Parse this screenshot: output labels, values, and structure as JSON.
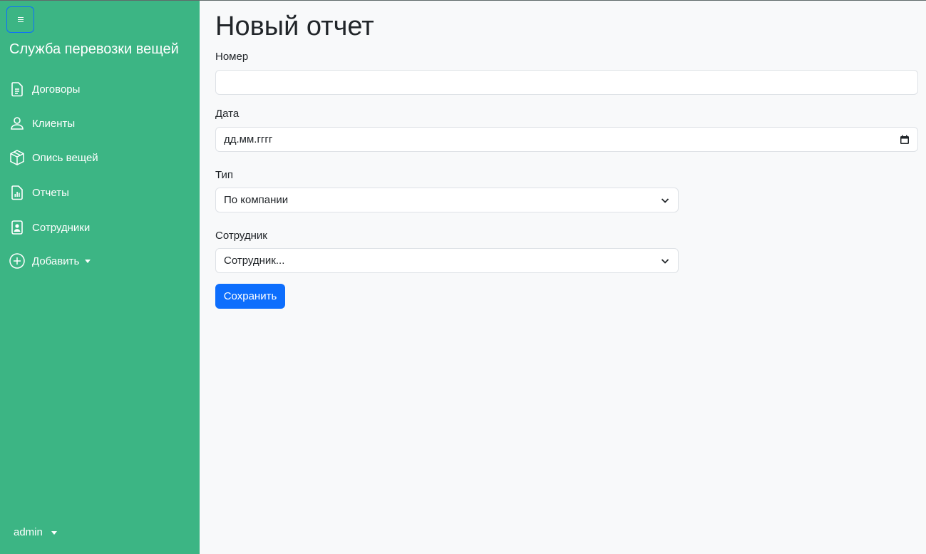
{
  "app": {
    "brand": "Служба перевозки вещей",
    "accent_color": "#3cb584",
    "primary_color": "#0d6efd"
  },
  "sidebar": {
    "toggle_icon": "menu-icon",
    "items": [
      {
        "label": "Договоры",
        "icon": "document-icon"
      },
      {
        "label": "Клиенты",
        "icon": "person-icon"
      },
      {
        "label": "Опись вещей",
        "icon": "box-icon"
      },
      {
        "label": "Отчеты",
        "icon": "report-icon"
      },
      {
        "label": "Сотрудники",
        "icon": "badge-icon"
      },
      {
        "label": "Добавить",
        "icon": "plus-circle-icon"
      }
    ],
    "user": "admin"
  },
  "form": {
    "title": "Новый отчет",
    "number": {
      "label": "Номер",
      "value": ""
    },
    "date": {
      "label": "Дата",
      "placeholder": "дд.мм.гггг",
      "icon": "calendar-icon"
    },
    "type": {
      "label": "Тип",
      "selected": "По компании"
    },
    "employee": {
      "label": "Сотрудник",
      "selected": "Сотрудник..."
    },
    "save_label": "Сохранить"
  }
}
